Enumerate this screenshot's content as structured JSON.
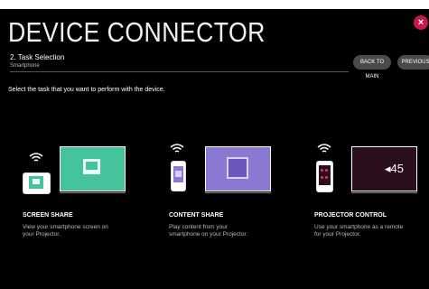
{
  "header": {
    "title": "DEVICE CONNECTOR",
    "step_title": "2. Task Selection",
    "step_subtitle": "Smartphone",
    "back_to_main_label": "BACK TO MAIN",
    "previous_label": "PREVIOUS",
    "close_label": "×"
  },
  "instruction": "Select the task that you want to perform with the device.",
  "tasks": [
    {
      "title": "SCREEN SHARE",
      "desc_line1": "View your smartphone screen on",
      "desc_line2": "your Projector."
    },
    {
      "title": "CONTENT SHARE",
      "desc_line1": "Play content from your",
      "desc_line2": "smartphone on your Projector."
    },
    {
      "title": "PROJECTOR CONTROL",
      "desc_line1": "Use your smartphone as a remote",
      "desc_line2": "for your Projector.",
      "volume_text": "◂45"
    }
  ],
  "colors": {
    "screen_share": "#45c39c",
    "content_share": "#8a78d2",
    "projector_control": "#2c0f1e",
    "close": "#c8174a"
  }
}
